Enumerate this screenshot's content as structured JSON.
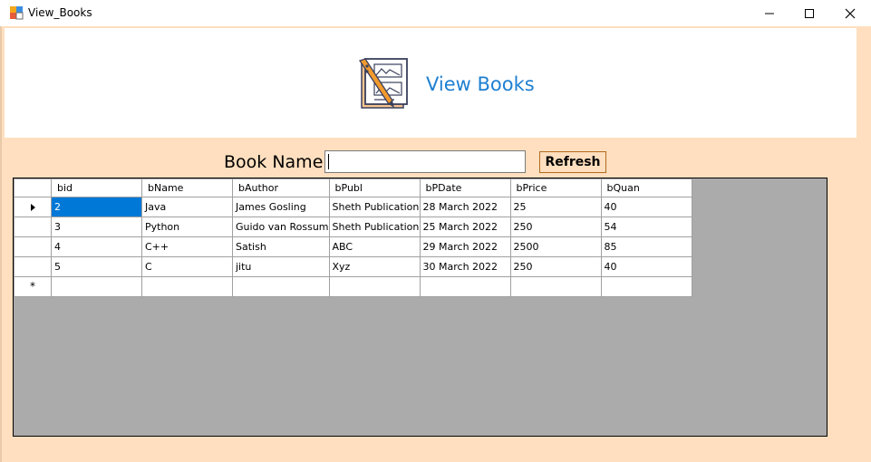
{
  "window": {
    "title": "View_Books",
    "icon": "form-icon",
    "controls": {
      "minimize": "minimize-icon",
      "maximize": "maximize-icon",
      "close": "close-icon"
    }
  },
  "header": {
    "title": "View Books",
    "icon": "books-icon",
    "title_color": "#1e7fd1"
  },
  "search": {
    "label": "Book Name",
    "value": "",
    "refresh_label": "Refresh"
  },
  "grid": {
    "columns": [
      "bid",
      "bName",
      "bAuthor",
      "bPubl",
      "bPDate",
      "bPrice",
      "bQuan"
    ],
    "rows": [
      [
        "2",
        "Java",
        "James Gosling",
        "Sheth Publication",
        "28 March 2022",
        "25",
        "40"
      ],
      [
        "3",
        "Python",
        "Guido van Rossum",
        "Sheth Publication",
        "25 March 2022",
        "250",
        "54"
      ],
      [
        "4",
        "C++",
        "Satish",
        "ABC",
        "29 March 2022",
        "2500",
        "85"
      ],
      [
        "5",
        "C",
        "jitu",
        "Xyz",
        "30 March 2022",
        "250",
        "40"
      ]
    ],
    "new_row_marker": "*",
    "selected_cell": {
      "row": 0,
      "column": 0
    }
  },
  "colors": {
    "form_background": "#ffdfbf",
    "grid_background": "#ababab",
    "selection": "#0078d7",
    "refresh_border": "#b26a1f"
  }
}
